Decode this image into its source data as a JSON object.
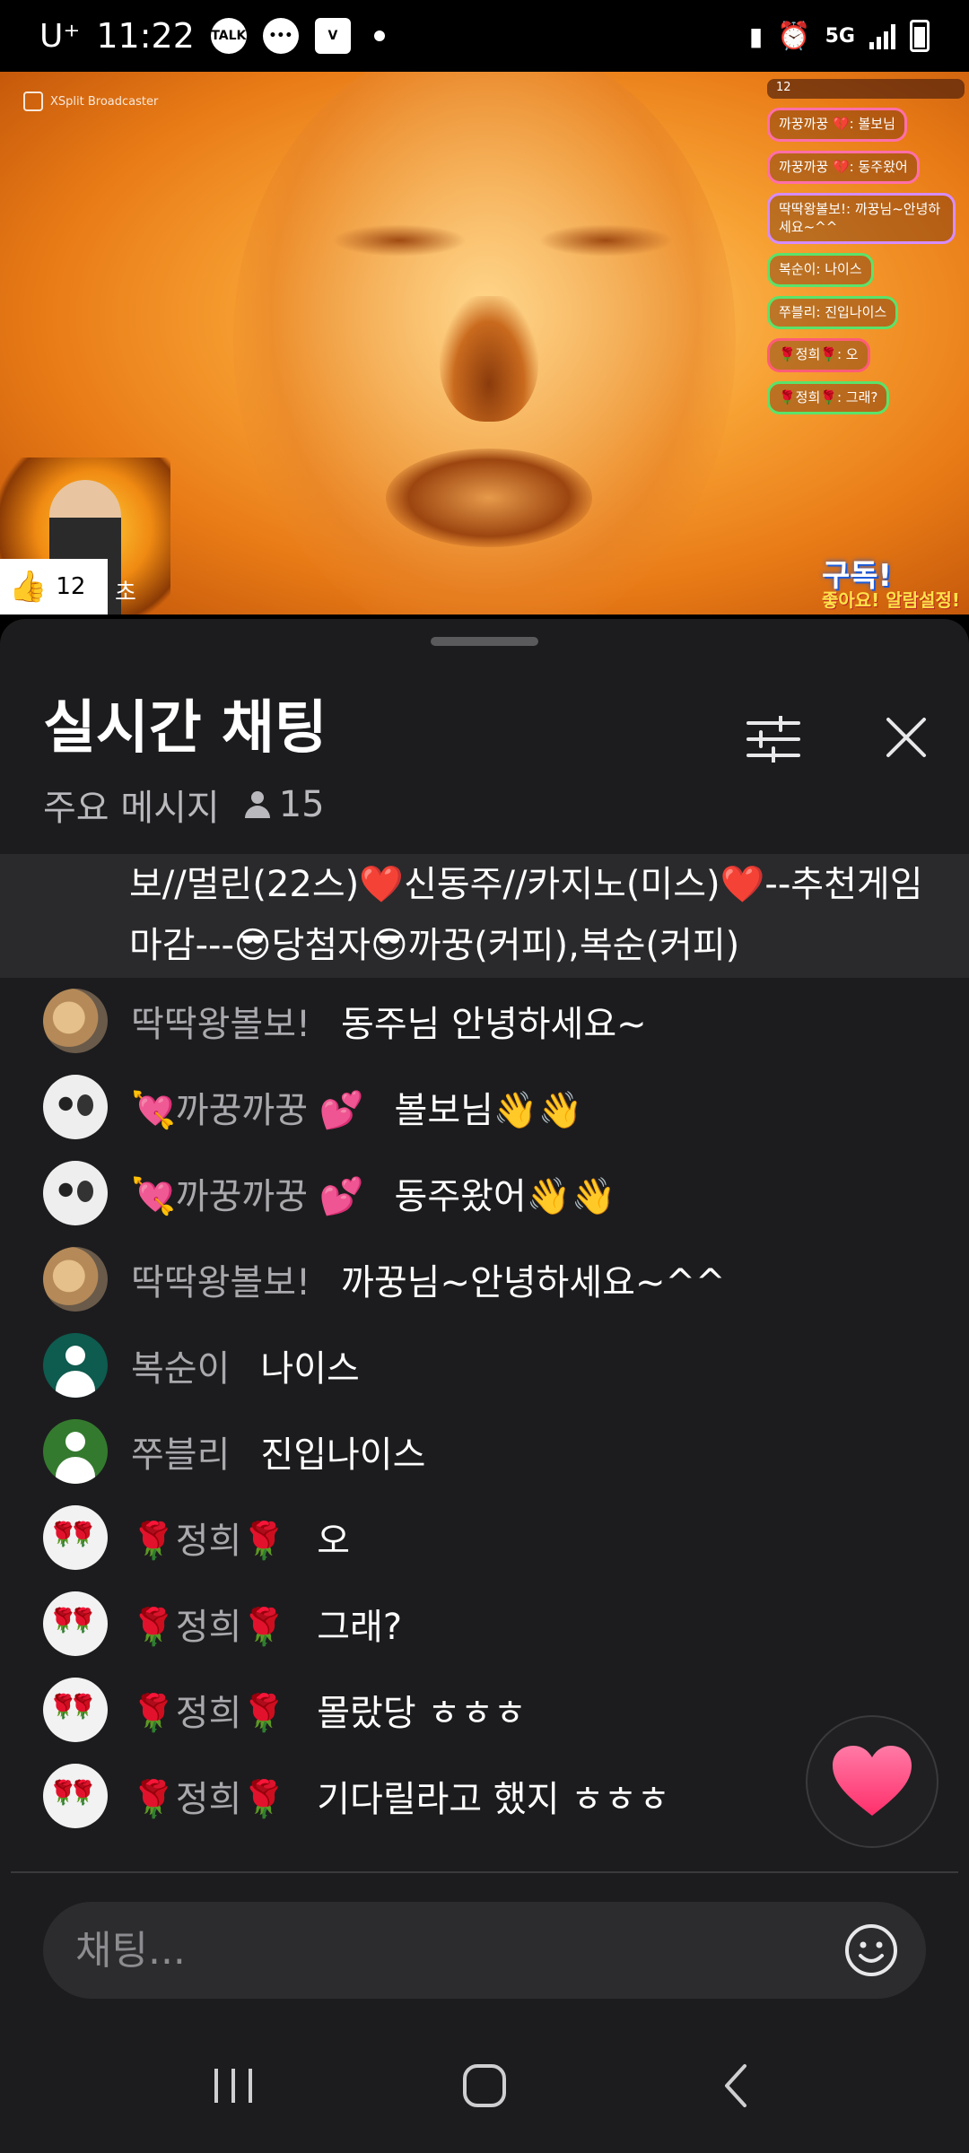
{
  "status_bar": {
    "carrier": "U⁺",
    "time": "11:22",
    "notif_icons": [
      "talk-icon",
      "chat-bubble-icon",
      "v-app-icon"
    ],
    "network": "5G"
  },
  "video": {
    "broadcaster_label": "XSplit Broadcaster",
    "overlay_top": "12",
    "overlay_messages": [
      {
        "text": "까꿍까꿍 💔: 볼보님",
        "color": "#ff6fa8"
      },
      {
        "text": "까꿍까꿍 💔: 동주왔어",
        "color": "#ff6fa8"
      },
      {
        "text": "딱딱왕볼보!: 까꿍님~안녕하세요~^^",
        "color": "#d68cff"
      },
      {
        "text": "복순이: 나이스",
        "color": "#5be36a"
      },
      {
        "text": "쭈블리: 진입나이스",
        "color": "#5be36a"
      },
      {
        "text": "🌹정희🌹: 오",
        "color": "#ff5c77"
      },
      {
        "text": "🌹정희🌹: 그래?",
        "color": "#5be36a"
      }
    ],
    "sub_badge": "구독!",
    "sub_badge_sub": "좋아요! 알람설정!",
    "like_count": "12",
    "cho_label": "초"
  },
  "chat_panel": {
    "title": "실시간 채팅",
    "filter_label": "주요 메시지",
    "viewer_count": "15",
    "pinned_text": "보//멀린(22스)❤️신동주//카지노(미스)❤️--추천게임마감---😎당첨자😎까꿍(커피),복순(커피)",
    "messages": [
      {
        "avatar": "food",
        "name": "딱딱왕볼보!",
        "text": "동주님 안녕하세요~"
      },
      {
        "avatar": "cats",
        "name": "💘까꿍까꿍 💕",
        "text": "볼보님👋👋"
      },
      {
        "avatar": "cats",
        "name": "💘까꿍까꿍 💕",
        "text": "동주왔어👋👋"
      },
      {
        "avatar": "food",
        "name": "딱딱왕볼보!",
        "text": "까꿍님~안녕하세요~^^"
      },
      {
        "avatar": "teal",
        "name": "복순이",
        "text": "나이스"
      },
      {
        "avatar": "green",
        "name": "쭈블리",
        "text": "진입나이스"
      },
      {
        "avatar": "rose",
        "name": "🌹정희🌹",
        "text": "오"
      },
      {
        "avatar": "rose",
        "name": "🌹정희🌹",
        "text": "그래?"
      },
      {
        "avatar": "rose",
        "name": "🌹정희🌹",
        "text": "몰랐당 ㅎㅎㅎ"
      },
      {
        "avatar": "rose",
        "name": "🌹정희🌹",
        "text": "기다릴라고 했지 ㅎㅎㅎ"
      }
    ],
    "input_placeholder": "채팅...",
    "heart_color": "#ff4f86"
  },
  "nav": {
    "icons": [
      "recents-icon",
      "home-icon",
      "back-icon"
    ]
  }
}
